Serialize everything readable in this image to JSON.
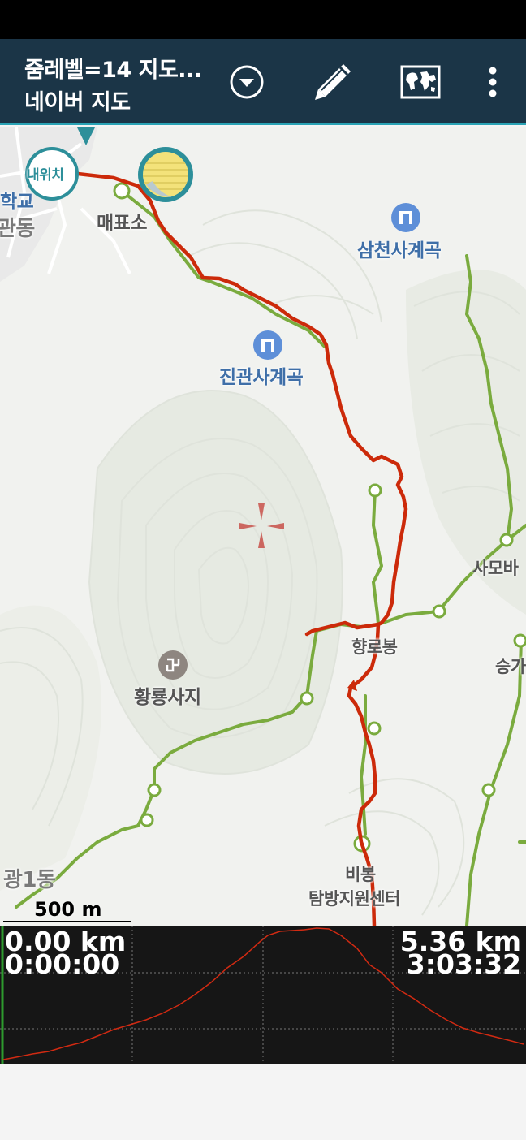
{
  "toolbar": {
    "title_line1": "줌레벨=14 지도...",
    "title_line2": "네이버 지도",
    "dropdown_icon": "chevron-down-circle-icon",
    "edit_icon": "pencil-icon",
    "map_icon": "world-map-icon",
    "more_icon": "more-vertical-icon"
  },
  "map": {
    "labels": {
      "school": "학교",
      "dong": "관동",
      "ticket_office": "매표소",
      "samcheon": "삼천사계곡",
      "jingwan": "진관사계곡",
      "hwangryong": "황룡사지",
      "hyangrobong": "향로봉",
      "samobawi": "사모바",
      "seungga": "승가",
      "gwang1dong": "광1동",
      "bibong": "비봉",
      "center": "탐방지원센터"
    },
    "my_location": "내위치",
    "scale": "500 m",
    "colors": {
      "track": "#cc2a0a",
      "trail": "#7aab3e"
    }
  },
  "profile": {
    "start_distance": "0.00 km",
    "start_time": "0:00:00",
    "end_distance": "5.36 km",
    "end_time": "3:03:32"
  }
}
